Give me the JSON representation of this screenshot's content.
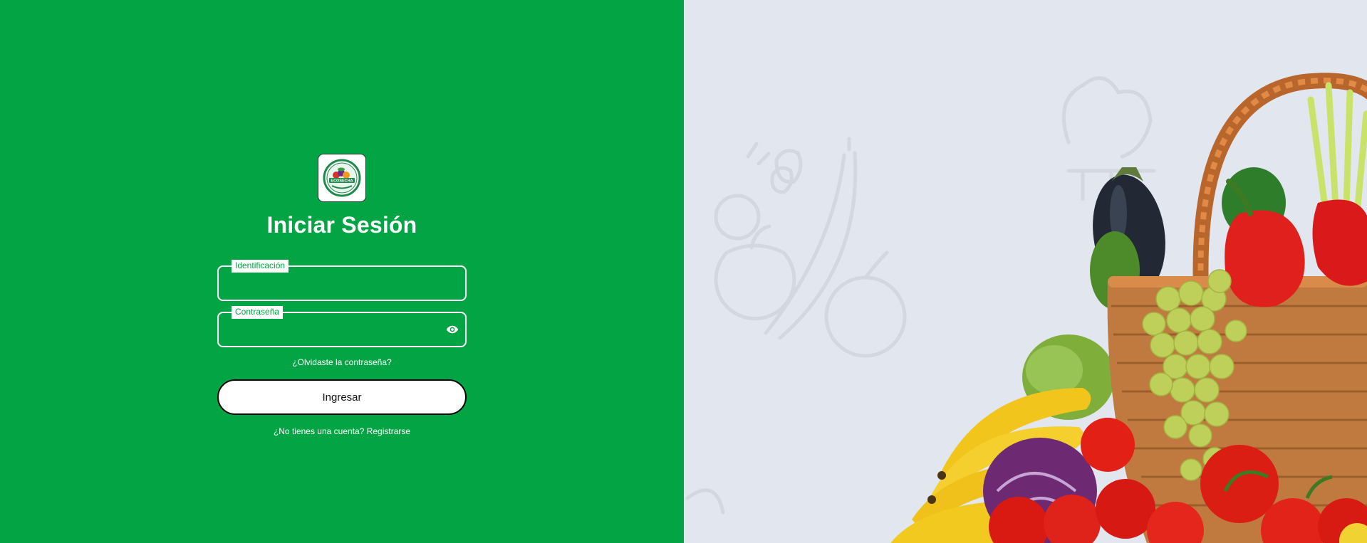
{
  "login": {
    "logo_text": "ECOSECHA",
    "title": "Iniciar Sesión",
    "identification_label": "Identificación",
    "identification_value": "",
    "password_label": "Contraseña",
    "password_value": "",
    "forgot_password": "¿Olvidaste la contraseña?",
    "submit_label": "Ingresar",
    "no_account_prompt": "¿No tienes una cuenta?",
    "register_link": "Registrarse"
  },
  "icons": {
    "show_password": "eye-icon",
    "logo": "ecosecha-logo"
  },
  "colors": {
    "brand_green": "#03a443",
    "right_background": "#e2e6ee",
    "white": "#ffffff"
  }
}
